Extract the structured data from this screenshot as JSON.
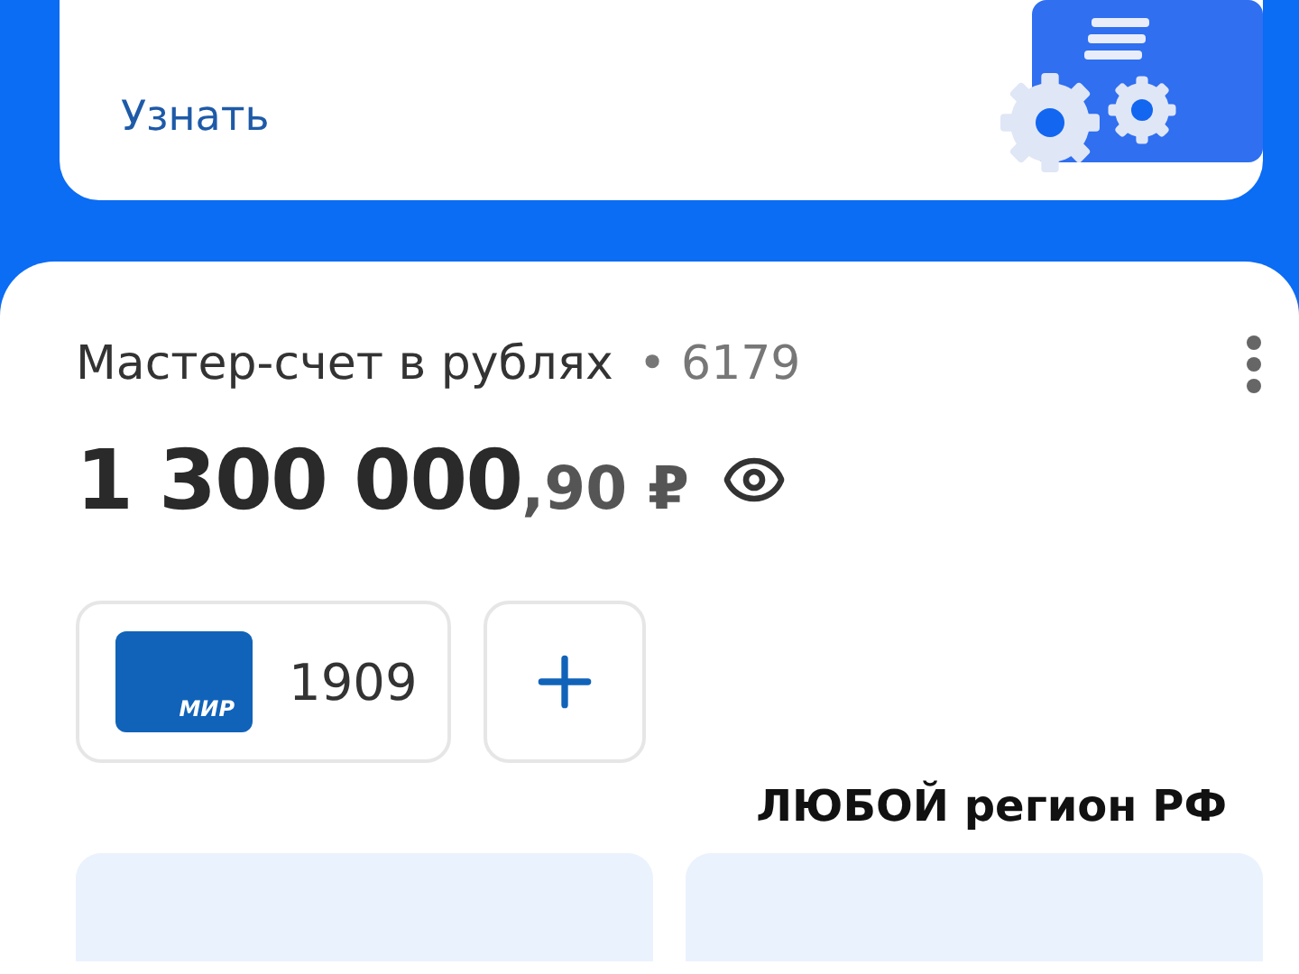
{
  "promo": {
    "link": "Узнать"
  },
  "account": {
    "name": "Мастер-счет в рублях",
    "number": "• 6179",
    "balance_main": "1 300 000",
    "balance_fraction": ",90 ₽"
  },
  "cards": [
    {
      "kind": "card",
      "brand": "МИР",
      "number": "1909"
    },
    {
      "kind": "add"
    }
  ],
  "overlay_text": "ЛЮБОЙ регион РФ"
}
